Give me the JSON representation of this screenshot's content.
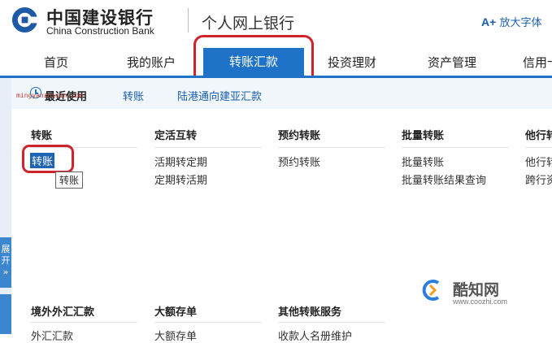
{
  "header": {
    "bank_name_cn": "中国建设银行",
    "bank_name_en": "China Construction Bank",
    "title": "个人网上银行",
    "font_button_icon": "A+",
    "font_button_label": "放大字体"
  },
  "nav": {
    "items": [
      {
        "label": "首页"
      },
      {
        "label": "我的账户"
      },
      {
        "label": "转账汇款",
        "active": true
      },
      {
        "label": "投资理财"
      },
      {
        "label": "资产管理"
      },
      {
        "label": "信用卡"
      }
    ]
  },
  "submenu": {
    "recent_label": "最近使用",
    "links": [
      "转账",
      "陆港通向建亚汇款"
    ],
    "overlay_user": "mingyanzhixin.com"
  },
  "columns": [
    {
      "title": "转账",
      "items": [
        "转账"
      ]
    },
    {
      "title": "定活互转",
      "items": [
        "活期转定期",
        "定期转活期"
      ]
    },
    {
      "title": "预约转账",
      "items": [
        "预约转账"
      ]
    },
    {
      "title": "批量转账",
      "items": [
        "批量转账",
        "批量转账结果查询"
      ]
    },
    {
      "title": "他行转账",
      "items": [
        "他行转",
        "跨行资"
      ]
    }
  ],
  "bottom_columns": [
    {
      "title": "境外外汇汇款",
      "items": [
        "外汇汇款"
      ]
    },
    {
      "title": "大额存单",
      "items": [
        "大额存单"
      ]
    },
    {
      "title": "其他转账服务",
      "items": [
        "收款人名册维护"
      ]
    }
  ],
  "tooltip": "转账",
  "strip_label": "展开",
  "strip_icon": "»",
  "watermark": {
    "name": "酷知网",
    "url": "www.coozhi.com"
  },
  "colors": {
    "accent": "#1e73c8",
    "highlight_border": "#d0222a",
    "link": "#1b5fad"
  }
}
